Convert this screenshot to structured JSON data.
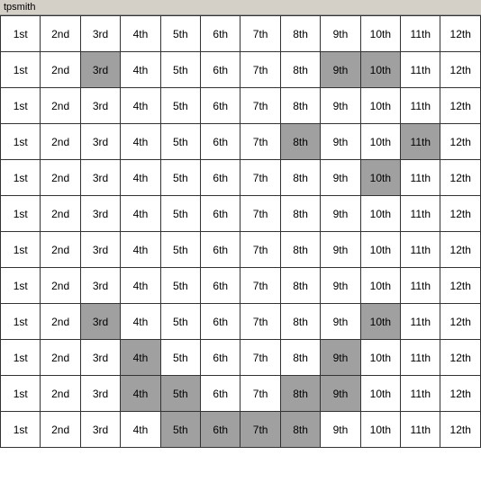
{
  "title": "tpsmith",
  "columns": [
    "1st",
    "2nd",
    "3rd",
    "4th",
    "5th",
    "6th",
    "7th",
    "8th",
    "9th",
    "10th",
    "11th",
    "12th"
  ],
  "rows": [
    {
      "cells": [
        {
          "val": "1st",
          "bg": "normal"
        },
        {
          "val": "2nd",
          "bg": "normal"
        },
        {
          "val": "3rd",
          "bg": "normal"
        },
        {
          "val": "4th",
          "bg": "normal"
        },
        {
          "val": "5th",
          "bg": "normal"
        },
        {
          "val": "6th",
          "bg": "normal"
        },
        {
          "val": "7th",
          "bg": "normal"
        },
        {
          "val": "8th",
          "bg": "normal"
        },
        {
          "val": "9th",
          "bg": "normal"
        },
        {
          "val": "10th",
          "bg": "normal"
        },
        {
          "val": "11th",
          "bg": "normal"
        },
        {
          "val": "12th",
          "bg": "normal"
        }
      ]
    },
    {
      "cells": [
        {
          "val": "1st",
          "bg": "normal"
        },
        {
          "val": "2nd",
          "bg": "normal"
        },
        {
          "val": "3rd",
          "bg": "gray"
        },
        {
          "val": "4th",
          "bg": "normal"
        },
        {
          "val": "5th",
          "bg": "normal"
        },
        {
          "val": "6th",
          "bg": "normal"
        },
        {
          "val": "7th",
          "bg": "normal"
        },
        {
          "val": "8th",
          "bg": "normal"
        },
        {
          "val": "9th",
          "bg": "gray"
        },
        {
          "val": "10th",
          "bg": "gray"
        },
        {
          "val": "11th",
          "bg": "normal"
        },
        {
          "val": "12th",
          "bg": "normal"
        }
      ]
    },
    {
      "cells": [
        {
          "val": "1st",
          "bg": "normal"
        },
        {
          "val": "2nd",
          "bg": "normal"
        },
        {
          "val": "3rd",
          "bg": "normal"
        },
        {
          "val": "4th",
          "bg": "normal"
        },
        {
          "val": "5th",
          "bg": "normal"
        },
        {
          "val": "6th",
          "bg": "normal"
        },
        {
          "val": "7th",
          "bg": "normal"
        },
        {
          "val": "8th",
          "bg": "normal"
        },
        {
          "val": "9th",
          "bg": "normal"
        },
        {
          "val": "10th",
          "bg": "normal"
        },
        {
          "val": "11th",
          "bg": "normal"
        },
        {
          "val": "12th",
          "bg": "normal"
        }
      ]
    },
    {
      "cells": [
        {
          "val": "1st",
          "bg": "normal"
        },
        {
          "val": "2nd",
          "bg": "normal"
        },
        {
          "val": "3rd",
          "bg": "normal"
        },
        {
          "val": "4th",
          "bg": "normal"
        },
        {
          "val": "5th",
          "bg": "normal"
        },
        {
          "val": "6th",
          "bg": "normal"
        },
        {
          "val": "7th",
          "bg": "normal"
        },
        {
          "val": "8th",
          "bg": "gray"
        },
        {
          "val": "9th",
          "bg": "normal"
        },
        {
          "val": "10th",
          "bg": "normal"
        },
        {
          "val": "11th",
          "bg": "gray"
        },
        {
          "val": "12th",
          "bg": "normal"
        }
      ]
    },
    {
      "cells": [
        {
          "val": "1st",
          "bg": "normal"
        },
        {
          "val": "2nd",
          "bg": "normal"
        },
        {
          "val": "3rd",
          "bg": "normal"
        },
        {
          "val": "4th",
          "bg": "normal"
        },
        {
          "val": "5th",
          "bg": "normal"
        },
        {
          "val": "6th",
          "bg": "normal"
        },
        {
          "val": "7th",
          "bg": "normal"
        },
        {
          "val": "8th",
          "bg": "normal"
        },
        {
          "val": "9th",
          "bg": "normal"
        },
        {
          "val": "10th",
          "bg": "gray"
        },
        {
          "val": "11th",
          "bg": "normal"
        },
        {
          "val": "12th",
          "bg": "normal"
        }
      ]
    },
    {
      "cells": [
        {
          "val": "1st",
          "bg": "normal"
        },
        {
          "val": "2nd",
          "bg": "normal"
        },
        {
          "val": "3rd",
          "bg": "normal"
        },
        {
          "val": "4th",
          "bg": "normal"
        },
        {
          "val": "5th",
          "bg": "normal"
        },
        {
          "val": "6th",
          "bg": "normal"
        },
        {
          "val": "7th",
          "bg": "normal"
        },
        {
          "val": "8th",
          "bg": "normal"
        },
        {
          "val": "9th",
          "bg": "normal"
        },
        {
          "val": "10th",
          "bg": "normal"
        },
        {
          "val": "11th",
          "bg": "normal"
        },
        {
          "val": "12th",
          "bg": "normal"
        }
      ]
    },
    {
      "cells": [
        {
          "val": "1st",
          "bg": "normal"
        },
        {
          "val": "2nd",
          "bg": "normal"
        },
        {
          "val": "3rd",
          "bg": "normal"
        },
        {
          "val": "4th",
          "bg": "normal"
        },
        {
          "val": "5th",
          "bg": "normal"
        },
        {
          "val": "6th",
          "bg": "normal"
        },
        {
          "val": "7th",
          "bg": "normal"
        },
        {
          "val": "8th",
          "bg": "normal"
        },
        {
          "val": "9th",
          "bg": "normal"
        },
        {
          "val": "10th",
          "bg": "normal"
        },
        {
          "val": "11th",
          "bg": "normal"
        },
        {
          "val": "12th",
          "bg": "normal"
        }
      ]
    },
    {
      "cells": [
        {
          "val": "1st",
          "bg": "normal"
        },
        {
          "val": "2nd",
          "bg": "normal"
        },
        {
          "val": "3rd",
          "bg": "normal"
        },
        {
          "val": "4th",
          "bg": "normal"
        },
        {
          "val": "5th",
          "bg": "normal"
        },
        {
          "val": "6th",
          "bg": "normal"
        },
        {
          "val": "7th",
          "bg": "normal"
        },
        {
          "val": "8th",
          "bg": "normal"
        },
        {
          "val": "9th",
          "bg": "normal"
        },
        {
          "val": "10th",
          "bg": "normal"
        },
        {
          "val": "11th",
          "bg": "normal"
        },
        {
          "val": "12th",
          "bg": "normal"
        }
      ]
    },
    {
      "cells": [
        {
          "val": "1st",
          "bg": "normal"
        },
        {
          "val": "2nd",
          "bg": "normal"
        },
        {
          "val": "3rd",
          "bg": "gray"
        },
        {
          "val": "4th",
          "bg": "normal"
        },
        {
          "val": "5th",
          "bg": "normal"
        },
        {
          "val": "6th",
          "bg": "normal"
        },
        {
          "val": "7th",
          "bg": "normal"
        },
        {
          "val": "8th",
          "bg": "normal"
        },
        {
          "val": "9th",
          "bg": "normal"
        },
        {
          "val": "10th",
          "bg": "gray"
        },
        {
          "val": "11th",
          "bg": "normal"
        },
        {
          "val": "12th",
          "bg": "normal"
        }
      ]
    },
    {
      "cells": [
        {
          "val": "1st",
          "bg": "normal"
        },
        {
          "val": "2nd",
          "bg": "normal"
        },
        {
          "val": "3rd",
          "bg": "normal"
        },
        {
          "val": "4th",
          "bg": "gray"
        },
        {
          "val": "5th",
          "bg": "normal"
        },
        {
          "val": "6th",
          "bg": "normal"
        },
        {
          "val": "7th",
          "bg": "normal"
        },
        {
          "val": "8th",
          "bg": "normal"
        },
        {
          "val": "9th",
          "bg": "gray"
        },
        {
          "val": "10th",
          "bg": "normal"
        },
        {
          "val": "11th",
          "bg": "normal"
        },
        {
          "val": "12th",
          "bg": "normal"
        }
      ]
    },
    {
      "cells": [
        {
          "val": "1st",
          "bg": "normal"
        },
        {
          "val": "2nd",
          "bg": "normal"
        },
        {
          "val": "3rd",
          "bg": "normal"
        },
        {
          "val": "4th",
          "bg": "gray"
        },
        {
          "val": "5th",
          "bg": "gray"
        },
        {
          "val": "6th",
          "bg": "normal"
        },
        {
          "val": "7th",
          "bg": "normal"
        },
        {
          "val": "8th",
          "bg": "gray"
        },
        {
          "val": "9th",
          "bg": "gray"
        },
        {
          "val": "10th",
          "bg": "normal"
        },
        {
          "val": "11th",
          "bg": "normal"
        },
        {
          "val": "12th",
          "bg": "normal"
        }
      ]
    },
    {
      "cells": [
        {
          "val": "1st",
          "bg": "normal"
        },
        {
          "val": "2nd",
          "bg": "normal"
        },
        {
          "val": "3rd",
          "bg": "normal"
        },
        {
          "val": "4th",
          "bg": "normal"
        },
        {
          "val": "5th",
          "bg": "gray"
        },
        {
          "val": "6th",
          "bg": "gray"
        },
        {
          "val": "7th",
          "bg": "gray"
        },
        {
          "val": "8th",
          "bg": "gray"
        },
        {
          "val": "9th",
          "bg": "normal"
        },
        {
          "val": "10th",
          "bg": "normal"
        },
        {
          "val": "11th",
          "bg": "normal"
        },
        {
          "val": "12th",
          "bg": "normal"
        }
      ]
    }
  ],
  "bg_colors": {
    "normal": "#ffffff",
    "gray": "#a0a0a0"
  }
}
